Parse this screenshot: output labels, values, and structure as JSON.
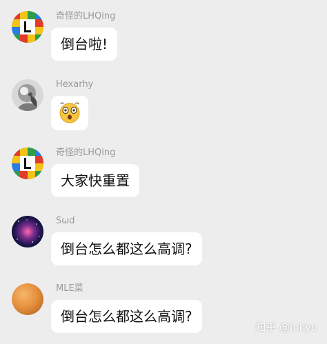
{
  "messages": [
    {
      "sender": "奇怪的LHQing",
      "text": "倒台啦!",
      "avatar": "mosaic-L-avatar"
    },
    {
      "sender": "Hexarhy",
      "text": "",
      "emoji": "surprised-face-icon",
      "avatar": "statue-avatar"
    },
    {
      "sender": "奇怪的LHQing",
      "text": "大家快重置",
      "avatar": "mosaic-L-avatar"
    },
    {
      "sender": "Sωd",
      "text": "倒台怎么都这么高调?",
      "avatar": "galaxy-avatar"
    },
    {
      "sender": "MLE菜",
      "text": "倒台怎么都这么高调?",
      "avatar": "orange-ball-avatar"
    }
  ],
  "watermark": "知乎 @inkyo",
  "colors": {
    "background": "#ededed",
    "bubble": "#ffffff",
    "name": "#9a9a9a",
    "text": "#111111"
  }
}
